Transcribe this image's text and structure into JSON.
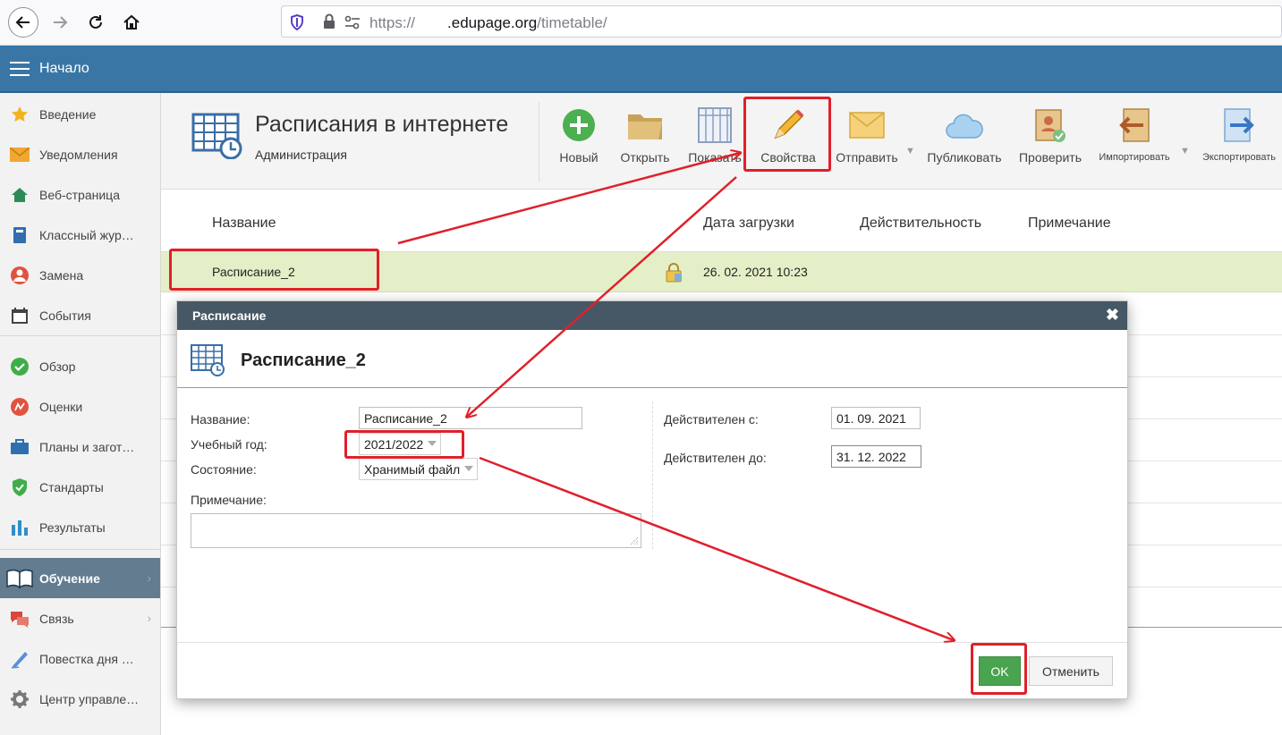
{
  "browser": {
    "url_prefix": "https://",
    "url_domain": ".edupage.org",
    "url_path": "/timetable/"
  },
  "header": {
    "title": "Начало"
  },
  "sidebar": {
    "items": [
      {
        "label": "Введение",
        "icon": "star-icon"
      },
      {
        "label": "Уведомления",
        "icon": "envelope-icon"
      },
      {
        "label": "Веб-страница",
        "icon": "home-icon"
      },
      {
        "label": "Классный жур…",
        "icon": "book-icon"
      },
      {
        "label": "Замена",
        "icon": "person-icon"
      },
      {
        "label": "События",
        "icon": "calendar-icon"
      },
      {
        "label": "Обзор",
        "icon": "check-circle-icon"
      },
      {
        "label": "Оценки",
        "icon": "grade-icon"
      },
      {
        "label": "Планы и загот…",
        "icon": "briefcase-icon"
      },
      {
        "label": "Стандарты",
        "icon": "shield-icon"
      },
      {
        "label": "Результаты",
        "icon": "bar-chart-icon"
      },
      {
        "label": "Обучение",
        "icon": "open-book-icon"
      },
      {
        "label": "Связь",
        "icon": "chat-icon"
      },
      {
        "label": "Повестка дня …",
        "icon": "pen-icon"
      },
      {
        "label": "Центр управле…",
        "icon": "gear-icon"
      }
    ]
  },
  "page": {
    "title": "Расписания в интернете",
    "subtitle": "Администрация"
  },
  "toolbar": {
    "new": "Новый",
    "open": "Открыть",
    "show": "Показать",
    "properties": "Свойства",
    "send": "Отправить",
    "publish": "Публиковать",
    "check": "Проверить",
    "import": "Импортировать",
    "export": "Экспортировать"
  },
  "list": {
    "columns": [
      "Название",
      "Дата загрузки",
      "Действительность",
      "Примечание"
    ],
    "rows": [
      {
        "name": "Расписание_2",
        "date": "26. 02. 2021 10:23"
      }
    ]
  },
  "dialog": {
    "bar_title": "Расписание",
    "close": "✖",
    "heading": "Расписание_2",
    "name_label": "Название:",
    "name_value": "Расписание_2",
    "year_label": "Учебный год:",
    "year_value": "2021/2022",
    "state_label": "Состояние:",
    "state_value": "Хранимый файл",
    "note_label": "Примечание:",
    "valid_from_label": "Действителен с:",
    "valid_from_value": "01. 09. 2021",
    "valid_to_label": "Действителен до:",
    "valid_to_value": "31. 12. 2022",
    "ok": "OK",
    "cancel": "Отменить"
  },
  "colors": {
    "header": "#3a76a5",
    "selected_row": "#e4efc8",
    "dialog_bar": "#465865",
    "ok_button": "#4aa34e",
    "annotation": "#e0202a"
  }
}
